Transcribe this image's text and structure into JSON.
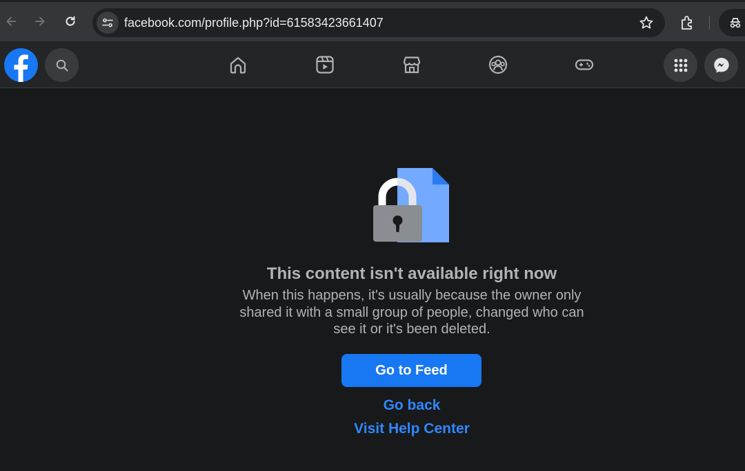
{
  "browser": {
    "url": "facebook.com/profile.php?id=61583423661407",
    "icons": [
      "back-arrow-icon",
      "forward-arrow-icon",
      "reload-icon",
      "site-settings-icon",
      "star-icon",
      "extensions-icon",
      "incognito-icon"
    ]
  },
  "facebook_nav": {
    "icons": [
      "facebook-logo-icon",
      "search-icon",
      "home-icon",
      "video-icon",
      "marketplace-icon",
      "groups-icon",
      "gaming-icon",
      "menu-grid-icon",
      "messenger-icon"
    ]
  },
  "main": {
    "title": "This content isn't available right now",
    "description": "When this happens, it's usually because the owner only shared it with a small group of people, changed who can see it or it's been deleted.",
    "primary_button": "Go to Feed",
    "go_back_link": "Go back",
    "help_link": "Visit Help Center"
  },
  "colors": {
    "background": "#18191a",
    "header": "#242526",
    "primary": "#1877f2",
    "link": "#2d88ff",
    "text_secondary": "#b0b3b8",
    "document_blue": "#73a9ff"
  }
}
